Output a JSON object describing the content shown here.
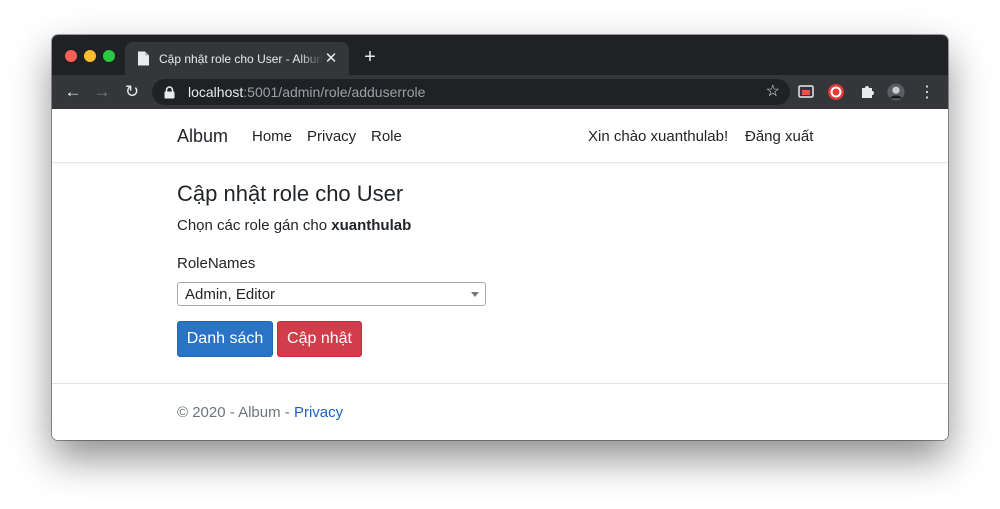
{
  "browser": {
    "tab_title": "Cập nhật role cho User - Album",
    "new_tab": "+",
    "close": "✕",
    "url_host": "localhost",
    "url_rest": ":5001/admin/role/adduserrole"
  },
  "navbar": {
    "brand": "Album",
    "links": [
      "Home",
      "Privacy",
      "Role"
    ],
    "greeting": "Xin chào xuanthulab!",
    "logout": "Đăng xuất"
  },
  "main": {
    "title": "Cập nhật role cho User",
    "intro_prefix": "Chọn các role gán cho ",
    "username": "xuanthulab",
    "field_label": "RoleNames",
    "select_value": "Admin, Editor",
    "btn_list": "Danh sách",
    "btn_update": "Cập nhật"
  },
  "footer": {
    "text": "© 2020 - Album - ",
    "link": "Privacy"
  },
  "colors": {
    "primary": "#2b73c5",
    "danger": "#d13d4a",
    "link": "#1a62c8"
  }
}
